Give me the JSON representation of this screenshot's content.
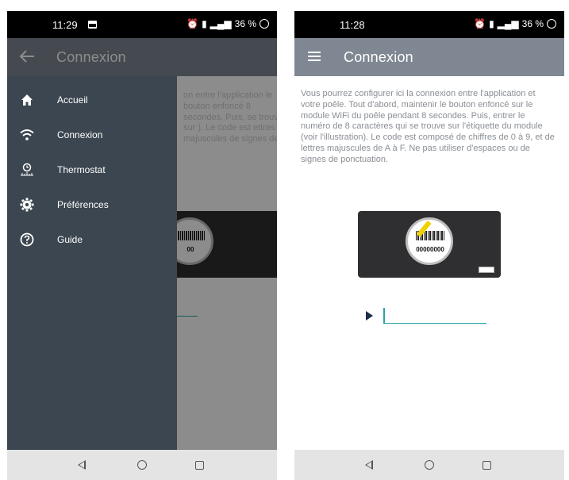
{
  "left": {
    "status": {
      "time": "11:29",
      "battery": "36 %",
      "signal": "4G"
    },
    "app_bar": {
      "title": "Connexion"
    },
    "drawer": {
      "items": [
        {
          "label": "Accueil",
          "icon": "home-icon"
        },
        {
          "label": "Connexion",
          "icon": "wifi-icon"
        },
        {
          "label": "Thermostat",
          "icon": "thermostat-icon"
        },
        {
          "label": "Préférences",
          "icon": "gear-icon"
        },
        {
          "label": "Guide",
          "icon": "help-icon"
        }
      ]
    },
    "hint_text": "on entre l'application le bouton enfoncé 8 secondes. Puis, se trouve sur ). Le code est ettres majuscules de signes de",
    "badge_code": "00"
  },
  "right": {
    "status": {
      "time": "11:28",
      "battery": "36 %",
      "signal": "4G"
    },
    "app_bar": {
      "title": "Connexion"
    },
    "instructions": "Vous pourrez configurer ici la connexion entre l'application et votre poêle. Tout d'abord, maintenir le bouton enfoncé sur le module WiFi du poêle pendant 8 secondes. Puis, entrer le numéro de 8 caractères qui se trouve sur l'étiquette du module (voir l'illustration). Le code est composé de chiffres de 0 à 9, et de lettres majuscules de A à F. Ne pas utiliser d'espaces ou de signes de ponctuation.",
    "badge_code": "00000000",
    "code_input_value": ""
  },
  "colors": {
    "app_bar": "#7f8892",
    "drawer": "#3c4650",
    "accent": "#2aa6a6",
    "arrow": "#1f2c48"
  }
}
